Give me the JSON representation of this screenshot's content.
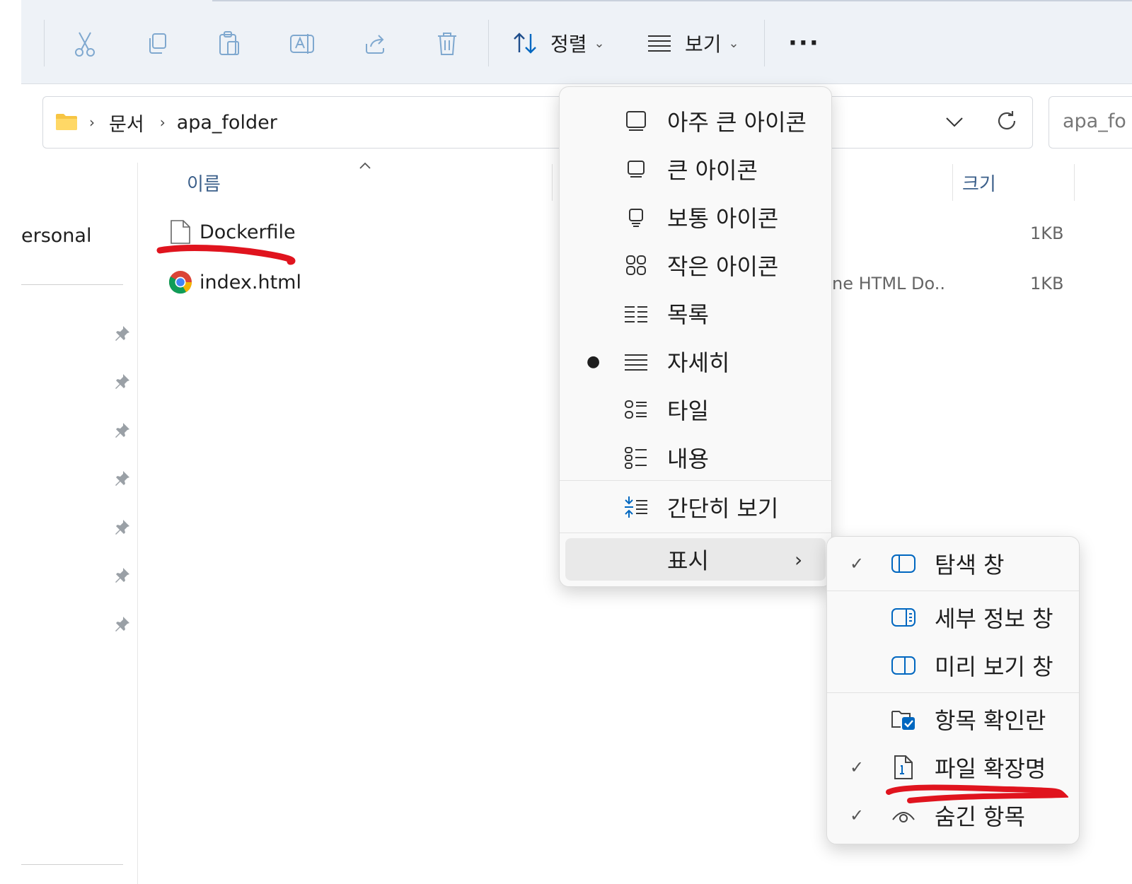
{
  "toolbar": {
    "sort_label": "정렬",
    "view_label": "보기",
    "more_label": "···"
  },
  "address": {
    "crumbs": [
      "문서",
      "apa_folder"
    ],
    "search_text": "apa_fo"
  },
  "nav": {
    "personal_label": "ersonal"
  },
  "columns": {
    "name": "이름",
    "size": "크기"
  },
  "files": [
    {
      "name": "Dockerfile",
      "type": "",
      "size": "1KB"
    },
    {
      "name": "index.html",
      "type": "ne HTML Do...",
      "size": "1KB"
    }
  ],
  "view_menu": {
    "items": [
      {
        "label": "아주 큰 아이콘",
        "icon": "extra-large-icons-icon"
      },
      {
        "label": "큰 아이콘",
        "icon": "large-icons-icon"
      },
      {
        "label": "보통 아이콘",
        "icon": "medium-icons-icon"
      },
      {
        "label": "작은 아이콘",
        "icon": "small-icons-icon"
      },
      {
        "label": "목록",
        "icon": "list-icon"
      },
      {
        "label": "자세히",
        "icon": "details-icon",
        "selected": true
      },
      {
        "label": "타일",
        "icon": "tiles-icon"
      },
      {
        "label": "내용",
        "icon": "content-icon"
      }
    ],
    "compact_label": "간단히 보기",
    "show_label": "표시"
  },
  "show_submenu": {
    "items": [
      {
        "label": "탐색 창",
        "checked": true
      },
      {
        "label": "세부 정보 창",
        "checked": false
      },
      {
        "label": "미리 보기 창",
        "checked": false
      },
      {
        "label": "항목 확인란",
        "checked": false
      },
      {
        "label": "파일 확장명",
        "checked": true
      },
      {
        "label": "숨긴 항목",
        "checked": true
      }
    ]
  },
  "colors": {
    "accent": "#0067c0",
    "annotation_red": "#e0141e"
  }
}
